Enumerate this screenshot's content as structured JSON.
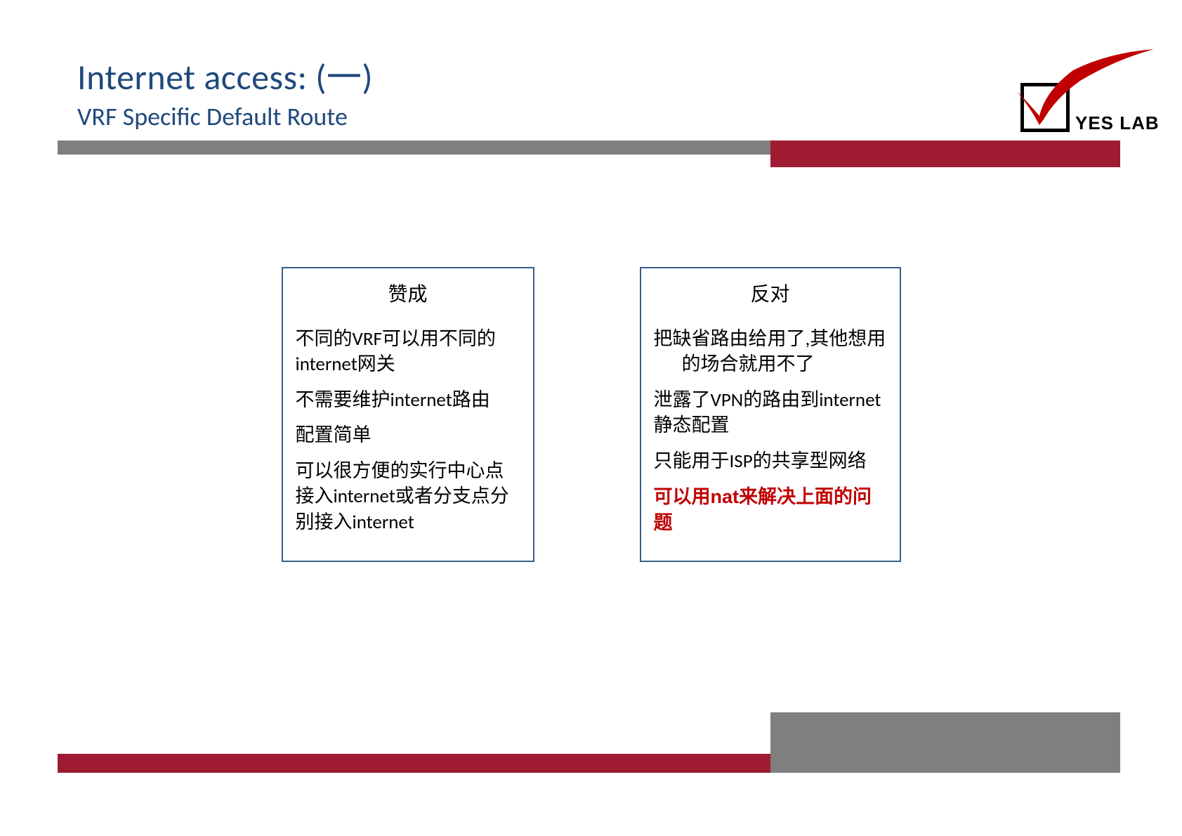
{
  "header": {
    "title": "Internet access: (一)",
    "subtitle": "VRF Specific Default Route"
  },
  "logo": {
    "text": "YES LAB"
  },
  "pros": {
    "title": "赞成",
    "items": [
      "不同的VRF可以用不同的internet网关",
      "不需要维护internet路由",
      "配置简单",
      "可以很方便的实行中心点接入internet或者分支点分别接入internet"
    ]
  },
  "cons": {
    "title": "反对",
    "items": [
      "把缺省路由给用了,其他想用的场合就用不了",
      "泄露了VPN的路由到internet静态配置",
      "只能用于ISP的共享型网络"
    ],
    "highlight": "可以用nat来解决上面的问题"
  }
}
